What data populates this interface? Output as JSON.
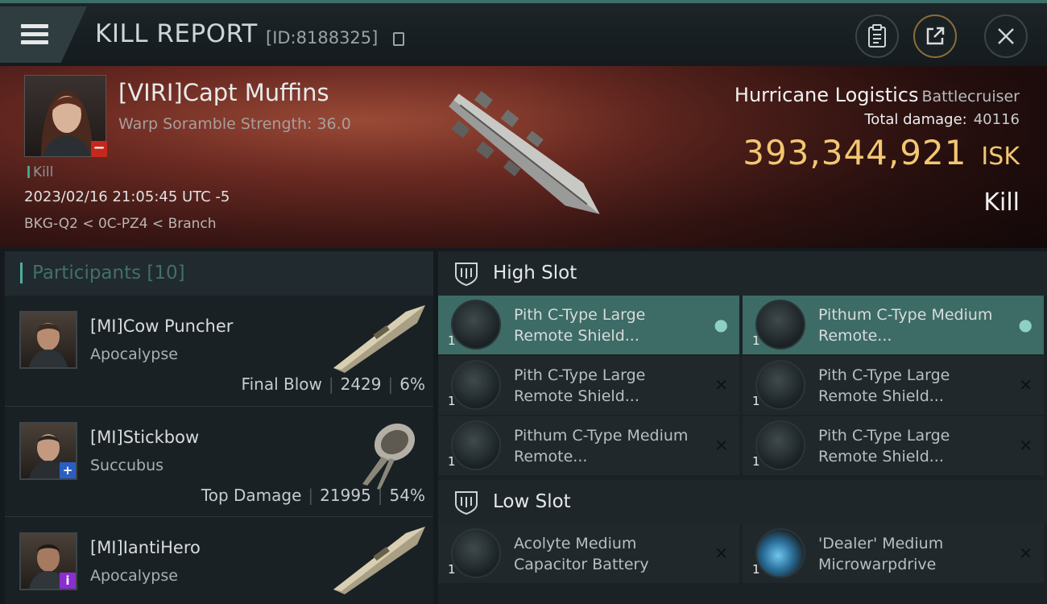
{
  "header": {
    "title": "KILL REPORT",
    "id_text": "[ID:8188325]",
    "buttons": [
      "clipboard-icon",
      "share-icon",
      "close-icon"
    ]
  },
  "victim": {
    "name": "[VIRI]Capt Muffins",
    "scramble": "Warp Soramble Strength: 36.0",
    "tag": "Kill",
    "datetime": "2023/02/16 21:05:45 UTC -5",
    "location": "BKG-Q2 < 0C-PZ4 < Branch",
    "ship": "Hurricane Logistics",
    "ship_class": "Battlecruiser",
    "damage_label": "Total damage:",
    "damage_value": "40116",
    "isk_value": "393,344,921",
    "isk_unit": "ISK",
    "result": "Kill"
  },
  "participants": {
    "label": "Participants",
    "count": "[10]",
    "rows": [
      {
        "name": "[MI]Cow Puncher",
        "ship": "Apocalypse",
        "tag": "Final Blow",
        "damage": "2429",
        "pct": "6%",
        "badge": ""
      },
      {
        "name": "[MI]Stickbow",
        "ship": "Succubus",
        "tag": "Top Damage",
        "damage": "21995",
        "pct": "54%",
        "badge": "+"
      },
      {
        "name": "[MI]IantiHero",
        "ship": "Apocalypse",
        "tag": "",
        "damage": "",
        "pct": "",
        "badge": "i"
      }
    ]
  },
  "high_slot": {
    "label": "High Slot",
    "modules": [
      {
        "qty": "1",
        "name": "Pith C-Type Large Remote Shield...",
        "status": "user"
      },
      {
        "qty": "1",
        "name": "Pithum C-Type Medium Remote...",
        "status": "user"
      },
      {
        "qty": "1",
        "name": "Pith C-Type Large Remote Shield...",
        "status": "x"
      },
      {
        "qty": "1",
        "name": "Pith C-Type Large Remote Shield...",
        "status": "x"
      },
      {
        "qty": "1",
        "name": "Pithum C-Type Medium Remote...",
        "status": "x"
      },
      {
        "qty": "1",
        "name": "Pith C-Type Large Remote Shield...",
        "status": "x"
      }
    ]
  },
  "low_slot": {
    "label": "Low Slot",
    "modules": [
      {
        "qty": "1",
        "name": "Acolyte Medium Capacitor Battery",
        "status": "x"
      },
      {
        "qty": "1",
        "name": "'Dealer' Medium Microwarpdrive",
        "status": "x"
      }
    ]
  },
  "colors": {
    "accent": "#3d6b66",
    "isk": "#f2c771",
    "badge_red": "#c5281c",
    "badge_blue": "#2a5fc2",
    "badge_purple": "#8a2ed0"
  }
}
